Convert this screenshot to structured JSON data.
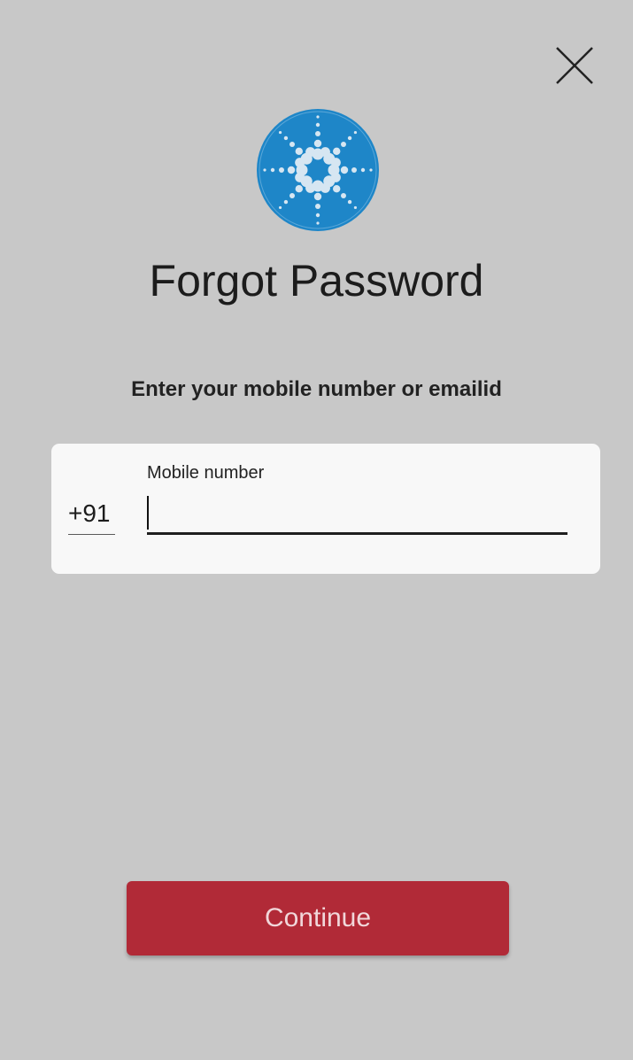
{
  "header": {
    "close_icon": "close-icon"
  },
  "logo": {
    "icon": "starburst-logo-icon",
    "circle_color": "#1e86c8",
    "dots_color": "#d6e6f2"
  },
  "title": "Forgot Password",
  "instruction": "Enter your mobile number or emailid",
  "form": {
    "country_code": "+91",
    "mobile_label": "Mobile number",
    "mobile_value": "",
    "mobile_placeholder": ""
  },
  "continue_button": {
    "label": "Continue",
    "color": "#b12a37"
  }
}
